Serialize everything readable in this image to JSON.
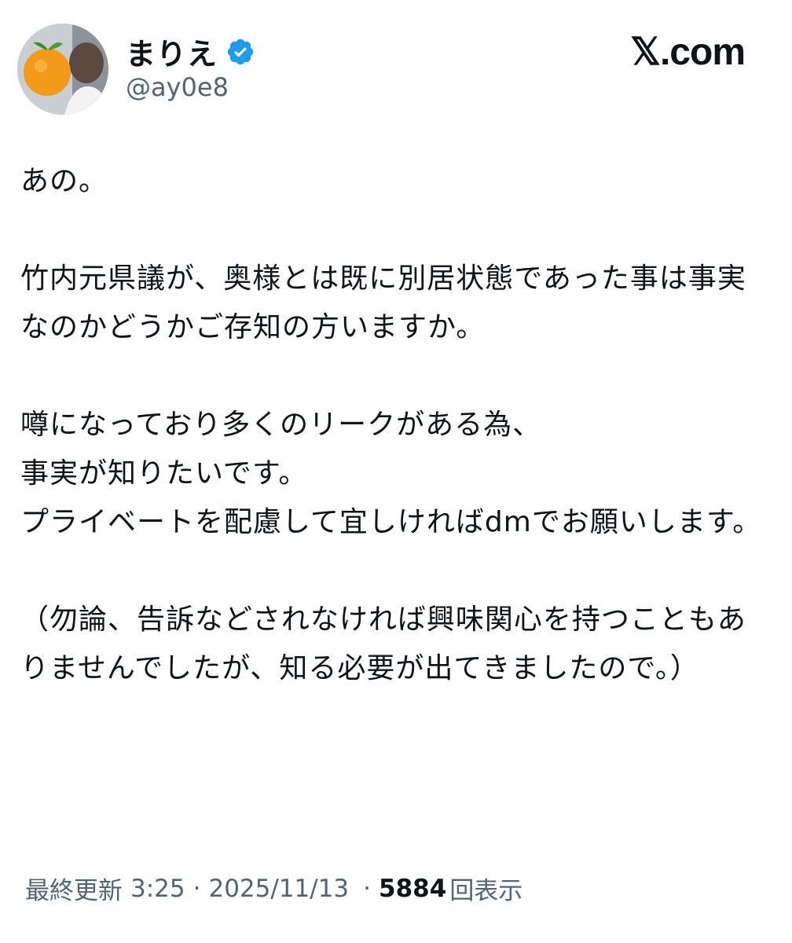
{
  "author": {
    "display_name": "まりえ",
    "handle": "@ay0e8",
    "verified": true,
    "badge_color": "#1d9bf0"
  },
  "brand": {
    "label": "𝕏.com"
  },
  "tweet": {
    "paragraphs": [
      "あの。",
      "竹内元県議が、奥様とは既に別居状態であった事は事実なのかどうかご存知の方いますか。",
      "噂になっており多くのリークがある為、\n事実が知りたいです。\nプライベートを配慮して宜しければdmでお願いします。",
      "（勿論、告訴などされなければ興味関心を持つこともありませんでしたが、知る必要が出てきましたので。）"
    ]
  },
  "meta": {
    "updated_label": "最終更新",
    "time": "3:25",
    "date": "2025/11/13",
    "separator": "·",
    "views_count": "5884",
    "views_label": "回表示"
  }
}
